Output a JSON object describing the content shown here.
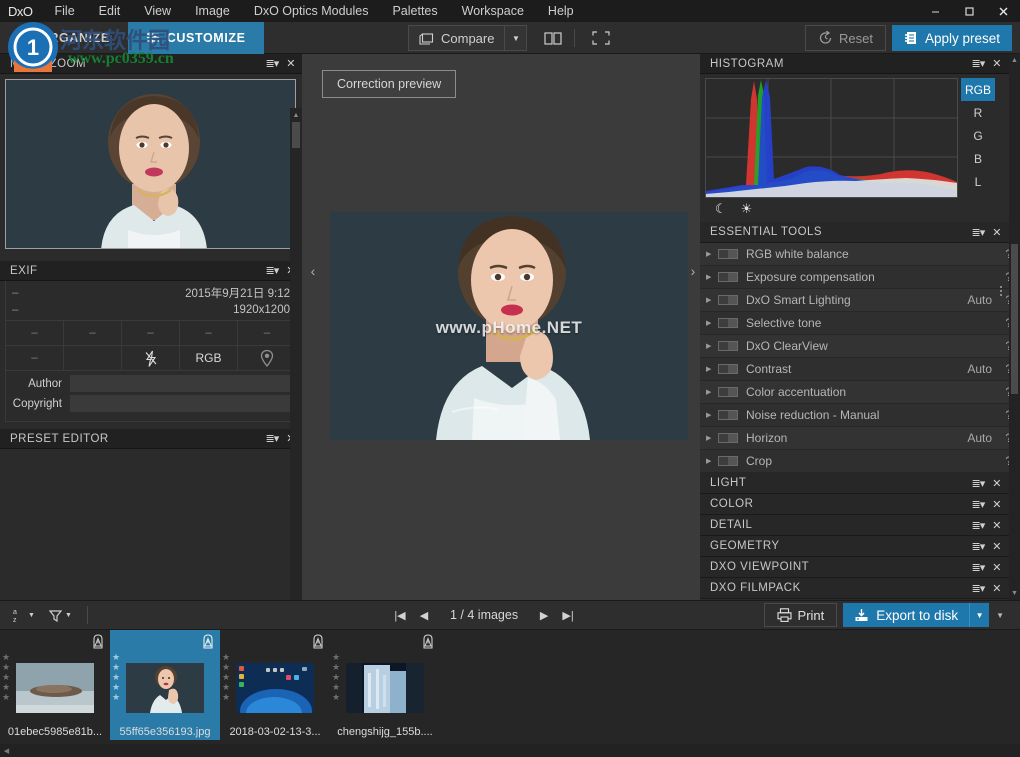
{
  "app": {
    "brand": "DxO",
    "window_buttons": {
      "minimize": "–",
      "maximize": "❐",
      "close": "✕"
    }
  },
  "menubar": {
    "items": [
      {
        "label": "File"
      },
      {
        "label": "Edit"
      },
      {
        "label": "View"
      },
      {
        "label": "Image"
      },
      {
        "label": "DxO Optics Modules"
      },
      {
        "label": "Palettes"
      },
      {
        "label": "Workspace"
      },
      {
        "label": "Help"
      }
    ]
  },
  "toolbar": {
    "tabs": [
      {
        "label": "ORGANIZE",
        "active": false
      },
      {
        "label": "CUSTOMIZE",
        "active": true
      }
    ],
    "compare_label": "Compare",
    "compare_caret": "▼",
    "split_view_tooltip": "split-view",
    "fullscreen_tooltip": "fullscreen",
    "reset_label": "Reset",
    "apply_preset_label": "Apply preset",
    "apply_caret": "▼"
  },
  "left_panel": {
    "move_zoom": {
      "title": "MOVE/ZOOM"
    },
    "exif": {
      "title": "EXIF",
      "rows": [
        {
          "left": "–",
          "right": "2015年9月21日 9:12"
        },
        {
          "left": "–",
          "right": "1920x1200"
        }
      ],
      "grid": [
        "–",
        "–",
        "–",
        "–",
        "–",
        "–",
        "",
        "flash-off-icon",
        "RGB",
        "location-icon"
      ],
      "fields": [
        {
          "label": "Author",
          "value": "",
          "placeholder": ""
        },
        {
          "label": "Copyright",
          "value": "",
          "placeholder": ""
        }
      ]
    },
    "preset_editor": {
      "title": "PRESET EDITOR"
    }
  },
  "center": {
    "correction_preview_label": "Correction preview",
    "image_watermark": "www.pHome.NET",
    "nav_prev": "‹",
    "nav_next": "›"
  },
  "right_panel": {
    "histogram": {
      "title": "HISTOGRAM",
      "channels": [
        {
          "label": "RGB",
          "active": true
        },
        {
          "label": "R",
          "active": false
        },
        {
          "label": "G",
          "active": false
        },
        {
          "label": "B",
          "active": false
        },
        {
          "label": "L",
          "active": false
        }
      ],
      "modes": [
        {
          "name": "shadows-moon-icon",
          "glyph": "☾"
        },
        {
          "name": "highlights-sun-icon",
          "glyph": "☀"
        }
      ]
    },
    "essential_tools": {
      "title": "ESSENTIAL TOOLS",
      "items": [
        {
          "label": "RGB white balance",
          "auto": "",
          "help": "?"
        },
        {
          "label": "Exposure compensation",
          "auto": "",
          "help": "?"
        },
        {
          "label": "DxO Smart Lighting",
          "auto": "Auto",
          "help": "?"
        },
        {
          "label": "Selective tone",
          "auto": "",
          "help": "?"
        },
        {
          "label": "DxO ClearView",
          "auto": "",
          "help": "?"
        },
        {
          "label": "Contrast",
          "auto": "Auto",
          "help": "?"
        },
        {
          "label": "Color accentuation",
          "auto": "",
          "help": "?"
        },
        {
          "label": "Noise reduction - Manual",
          "auto": "",
          "help": "?"
        },
        {
          "label": "Horizon",
          "auto": "Auto",
          "help": "?"
        },
        {
          "label": "Crop",
          "auto": "",
          "help": "?"
        }
      ]
    },
    "sections": [
      {
        "title": "LIGHT"
      },
      {
        "title": "COLOR"
      },
      {
        "title": "DETAIL"
      },
      {
        "title": "GEOMETRY"
      },
      {
        "title": "DXO VIEWPOINT"
      },
      {
        "title": "DXO FILMPACK"
      }
    ]
  },
  "bottom_bar": {
    "sort_label": "a-z sort",
    "filter_label": "filter",
    "first_icon": "|◀",
    "prev_icon": "◀",
    "next_icon": "▶",
    "last_icon": "▶|",
    "image_count": "1 / 4  images",
    "print_label": "Print",
    "export_label": "Export to disk",
    "export_caret": "▼",
    "overflow_caret": "▼"
  },
  "filmstrip": {
    "thumbnails": [
      {
        "filename": "01ebec5985e81b...",
        "selected": false,
        "stars": 5,
        "badge": "warning-icon"
      },
      {
        "filename": "55ff65e356193.jpg",
        "selected": true,
        "stars": 5,
        "badge": "warning-icon"
      },
      {
        "filename": "2018-03-02-13-3...",
        "selected": false,
        "stars": 5,
        "badge": "warning-icon"
      },
      {
        "filename": "chengshijg_155b....",
        "selected": false,
        "stars": 5,
        "badge": "warning-icon"
      }
    ]
  },
  "watermark": {
    "chinese": "河东软件园",
    "url": "www.pc0359.cn"
  },
  "colors": {
    "accent": "#1e78ab",
    "tab_active": "#2b7ba8",
    "panel_bg": "#2b2b2b",
    "header_bg": "#212121",
    "canvas_bg": "#3b3b3b"
  }
}
